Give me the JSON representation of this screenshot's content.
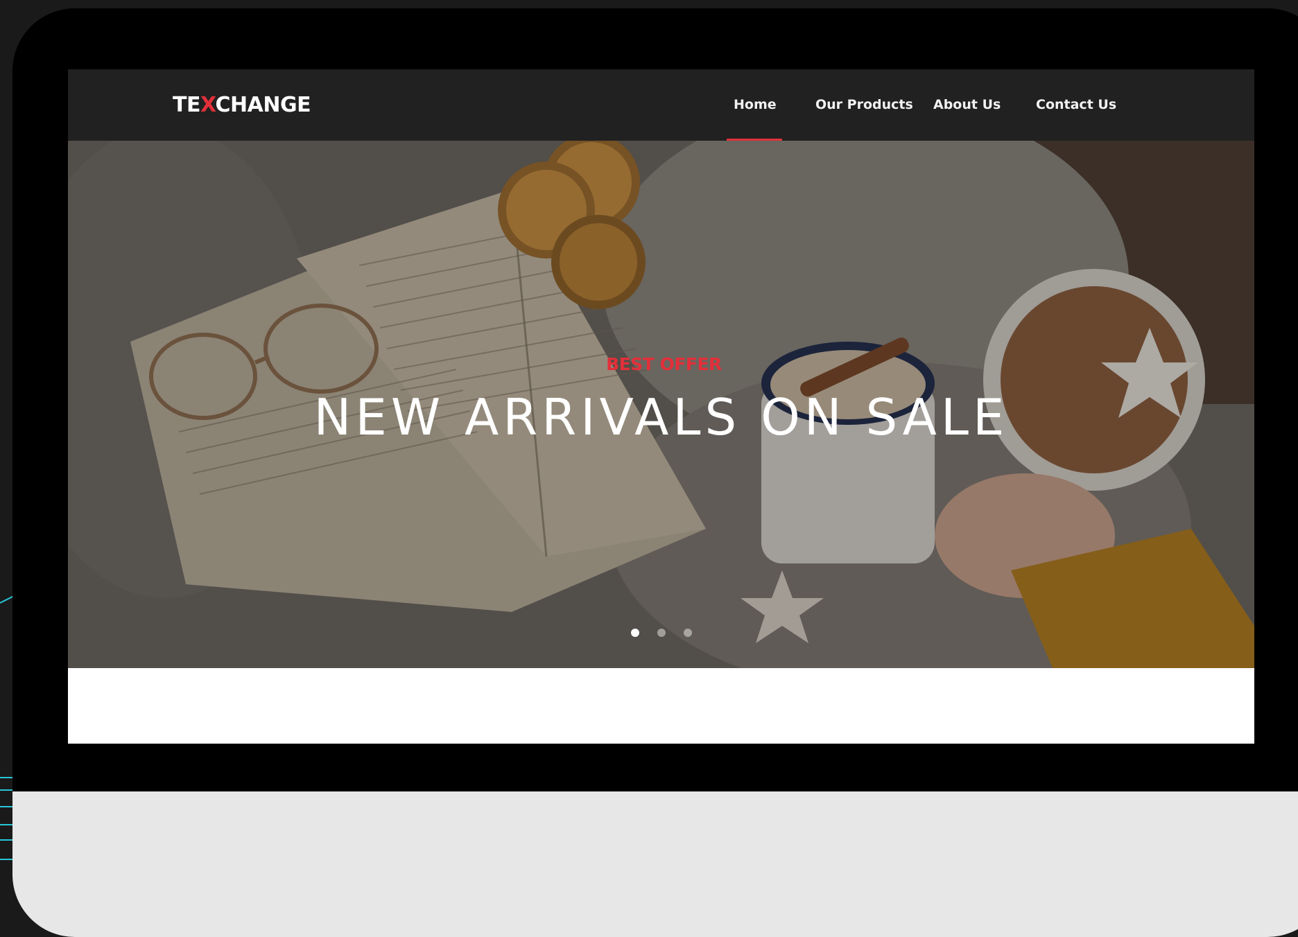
{
  "site": {
    "logo_prefix": "TE",
    "logo_accent": "X",
    "logo_suffix": "CHANGE"
  },
  "nav": {
    "items": [
      {
        "label": "Home",
        "active": true
      },
      {
        "label": "Our Products",
        "active": false
      },
      {
        "label": "About Us",
        "active": false
      },
      {
        "label": "Contact Us",
        "active": false
      }
    ]
  },
  "hero": {
    "kicker": "BEST OFFER",
    "title": "NEW ARRIVALS ON SALE",
    "slide_count": 3,
    "active_slide": 1
  },
  "colors": {
    "accent": "#e2303a",
    "navbar": "#212121",
    "frame": "#000000",
    "chin": "#e7e7e7",
    "decor_lines": "#27c6d8"
  }
}
